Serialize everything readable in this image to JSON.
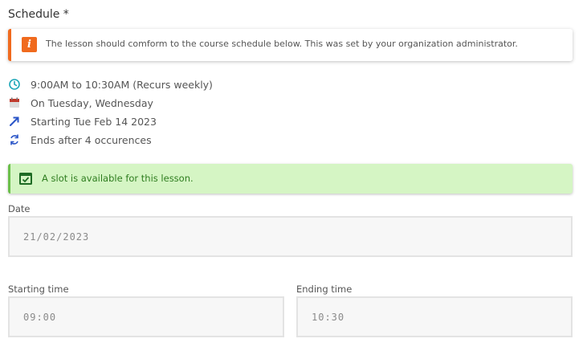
{
  "schedule": {
    "title": "Schedule *",
    "notice": "The lesson should comform to the course schedule below. This was set by your organization administrator.",
    "details": [
      {
        "icon": "clock-icon",
        "text": "9:00AM to 10:30AM (Recurs weekly)"
      },
      {
        "icon": "calendar-icon",
        "text": "On Tuesday, Wednesday"
      },
      {
        "icon": "arrow-up-right-icon",
        "text": "Starting Tue Feb 14 2023"
      },
      {
        "icon": "repeat-icon",
        "text": "Ends after 4 occurences"
      }
    ],
    "availability": "A slot is available for this lesson."
  },
  "form": {
    "date_label": "Date",
    "date_value": "21/02/2023",
    "start_label": "Starting time",
    "start_value": "09:00",
    "end_label": "Ending time",
    "end_value": "10:30"
  },
  "colors": {
    "warning": "#f06a1e",
    "success_bg": "#d5f5c4",
    "success_text": "#2e7d1f",
    "clock": "#1fa7b8",
    "calendar": "#c0392b",
    "arrow": "#2a55c7",
    "repeat": "#2a55c7"
  }
}
